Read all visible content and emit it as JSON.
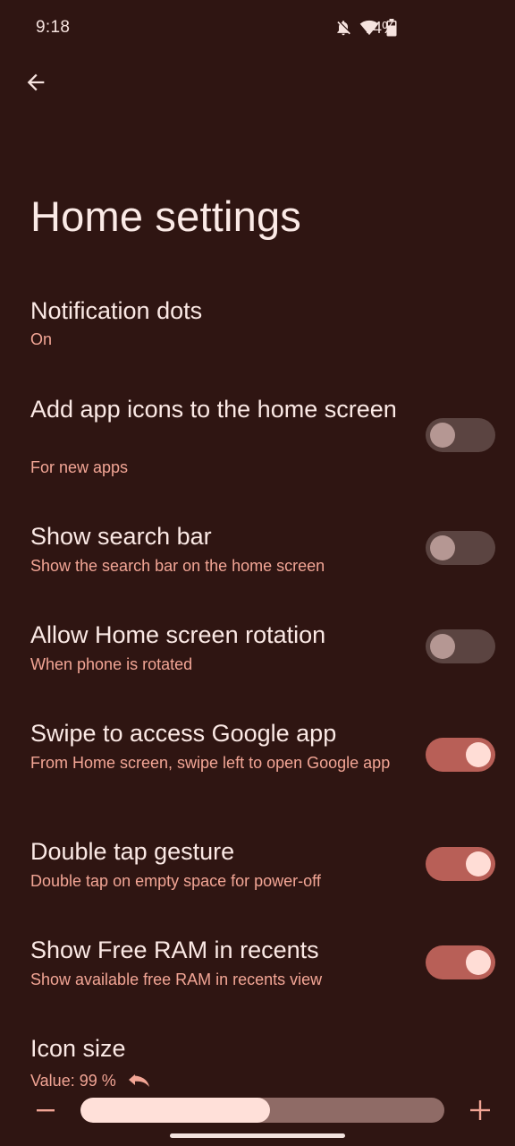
{
  "status_bar": {
    "time": "9:18",
    "battery": "74%",
    "icons": [
      "notifications-off-icon",
      "wifi-icon",
      "battery-icon"
    ]
  },
  "header": {
    "back_icon": "arrow-left-icon",
    "title": "Home settings"
  },
  "settings": [
    {
      "title": "Notification dots",
      "summary": "On"
    },
    {
      "title": "Add app icons to the home screen",
      "summary": "For new apps",
      "toggle": "off"
    },
    {
      "title": "Show search bar",
      "summary": "Show the search bar on the home screen",
      "toggle": "off"
    },
    {
      "title": "Allow Home screen rotation",
      "summary": "When phone is rotated",
      "toggle": "off"
    },
    {
      "title": "Swipe to access Google app",
      "summary": "From Home screen, swipe left to open Google app",
      "toggle": "on"
    },
    {
      "title": "Double tap gesture",
      "summary": "Double tap on empty space for power-off",
      "toggle": "on"
    },
    {
      "title": "Show Free RAM in recents",
      "summary": "Show available free RAM in recents view",
      "toggle": "on"
    }
  ],
  "icon_size": {
    "title": "Icon size",
    "value_text": "Value: 99 %",
    "slider_fraction": 0.52,
    "reset_icon": "undo-icon",
    "minus_icon": "minus-icon",
    "plus_icon": "plus-icon"
  },
  "colors": {
    "background": "#2f1512",
    "accent": "#f2a595",
    "toggle_on": "#b85f57",
    "toggle_off": "#5b4441"
  }
}
